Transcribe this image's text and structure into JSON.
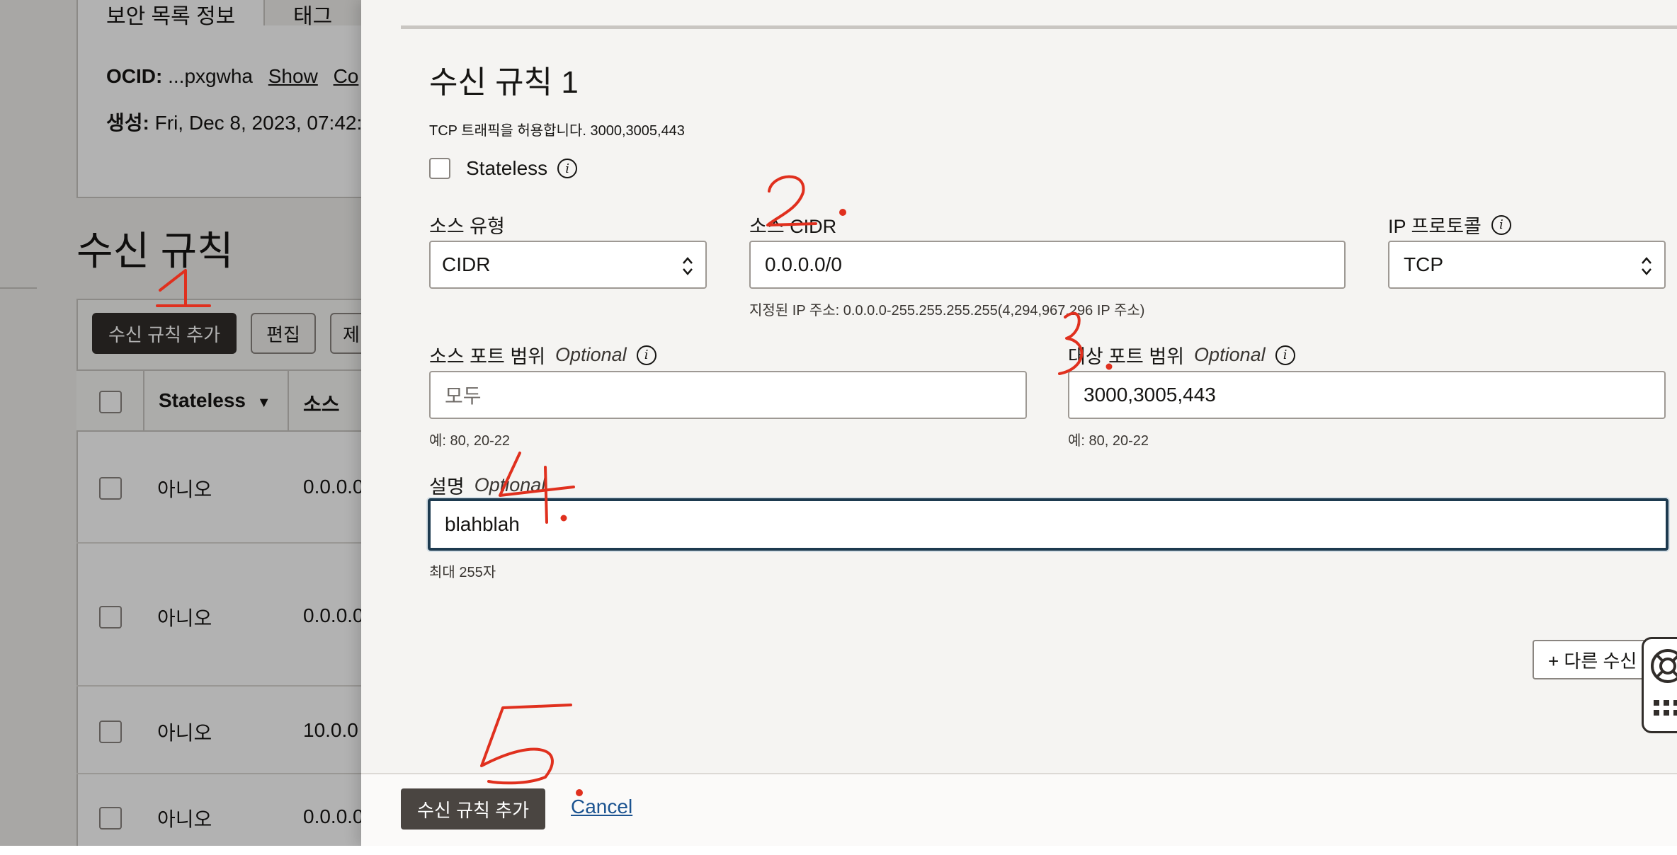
{
  "background": {
    "tabs": [
      "보안 목록 정보",
      "태그"
    ],
    "ocid_label": "OCID:",
    "ocid_value": "...pxgwha",
    "ocid_show": "Show",
    "ocid_copy": "Co",
    "created_label": "생성:",
    "created_value": "Fri, Dec 8, 2023, 07:42::",
    "section_title": "수신 규칙",
    "add_rule_button": "수신 규칙 추가",
    "edit_button": "편집",
    "remove_button": "제",
    "columns": [
      "Stateless",
      "소스"
    ],
    "rows": [
      {
        "stateless": "아니오",
        "source": "0.0.0.0"
      },
      {
        "stateless": "아니오",
        "source": "0.0.0.0"
      },
      {
        "stateless": "아니오",
        "source": "10.0.0"
      },
      {
        "stateless": "아니오",
        "source": "0.0.0.0"
      }
    ]
  },
  "panel": {
    "title": "수신 규칙 1",
    "description": "TCP 트래픽을 허용합니다. 3000,3005,443",
    "stateless_label": "Stateless",
    "source_type": {
      "label": "소스 유형",
      "value": "CIDR"
    },
    "source_cidr": {
      "label": "소스 CIDR",
      "value": "0.0.0.0/0",
      "hint": "지정된 IP 주소: 0.0.0.0-255.255.255.255(4,294,967,296 IP 주소)"
    },
    "ip_protocol": {
      "label": "IP 프로토콜",
      "value": "TCP"
    },
    "source_port": {
      "label": "소스 포트 범위",
      "optional": "Optional",
      "placeholder": "모두",
      "hint": "예: 80, 20-22"
    },
    "dest_port": {
      "label": "대상 포트 범위",
      "optional": "Optional",
      "value": "3000,3005,443",
      "hint": "예: 80, 20-22"
    },
    "description_field": {
      "label": "설명",
      "optional": "Optional",
      "value": "blahblah",
      "hint": "최대 255자"
    },
    "add_another_button": "+ 다른 수신",
    "footer": {
      "submit": "수신 규칙 추가",
      "cancel": "Cancel"
    }
  },
  "annotations": {
    "color": "#e0301e",
    "labels": [
      "1",
      "2",
      "3",
      "4",
      "5"
    ]
  }
}
